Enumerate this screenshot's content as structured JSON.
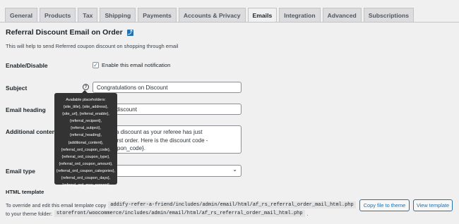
{
  "tabs": [
    {
      "label": "General"
    },
    {
      "label": "Products"
    },
    {
      "label": "Tax"
    },
    {
      "label": "Shipping"
    },
    {
      "label": "Payments"
    },
    {
      "label": "Accounts & Privacy"
    },
    {
      "label": "Emails",
      "active": true
    },
    {
      "label": "Integration"
    },
    {
      "label": "Advanced"
    },
    {
      "label": "Subscriptions"
    }
  ],
  "page": {
    "title": "Referral Discount Email on Order",
    "back_icon": "up-arrow-icon",
    "description": "This will help to send Referred coupon discount on shopping through email"
  },
  "fields": {
    "enable_label": "Enable/Disable",
    "enable_checkbox_label": "Enable this email notification",
    "enable_checked": true,
    "subject_label": "Subject",
    "subject_value": "Congratulations on Discount",
    "heading_label": "Email heading",
    "heading_value": "earned discount",
    "content_label": "Additional content",
    "content_value": "earned a discount as your referee has just\nd their first order. Here is the discount code -\nord_coupon_code}.",
    "type_label": "Email type"
  },
  "tooltip": {
    "lines": [
      "Available placeholders:",
      "{site_title}, {site_address},",
      "{site_url}, {referral_enable},",
      "{referral_recipent},",
      "{referral_subject},",
      "{referral_heading},",
      "{additional_content},",
      "{referral_ord_coupon_code},",
      "{referral_ord_coupon_type},",
      "{referral_ord_coupon_amount},",
      "{referral_ord_coupon_categories},",
      "{referral_ord_coupon_days},",
      "{referral_ord_max_percent}"
    ]
  },
  "template": {
    "heading": "HTML template",
    "line1_text": "To override and edit this email template copy",
    "line1_code": "addify-refer-a-friend/includes/admin/email/html/af_rs_referral_order_mail_html.php",
    "line2_text": "to your theme folder:",
    "line2_code": "storefront/woocommerce/includes/admin/email/html/af_rs_referral_order_mail_html.php",
    "line2_end": ".",
    "copy_button": "Copy file to theme",
    "view_button": "View template"
  }
}
